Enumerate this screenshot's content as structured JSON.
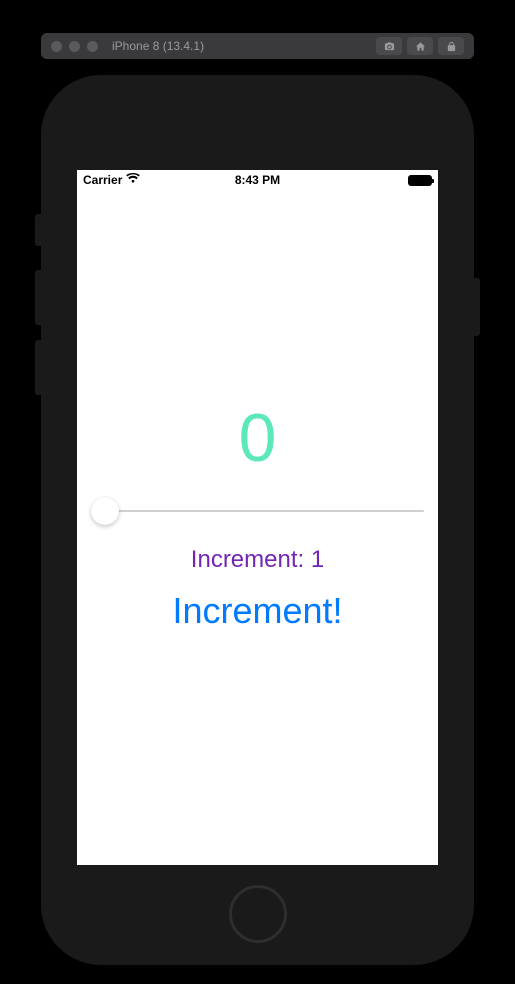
{
  "simulator": {
    "title": "iPhone 8 (13.4.1)"
  },
  "status_bar": {
    "carrier": "Carrier",
    "time": "8:43 PM"
  },
  "app": {
    "counter_value": "0",
    "increment_label": "Increment: 1",
    "increment_button": "Increment!"
  },
  "colors": {
    "counter": "#5ce8bb",
    "increment_label": "#7325b5",
    "increment_button": "#007aff"
  }
}
